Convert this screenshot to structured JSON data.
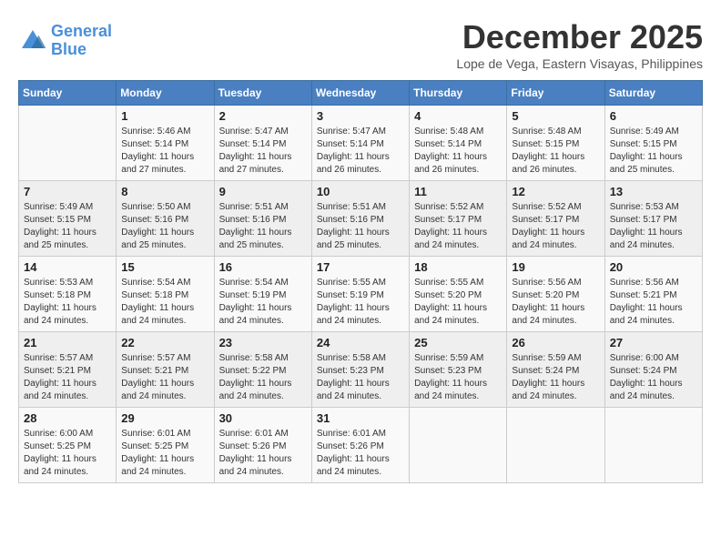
{
  "header": {
    "logo_line1": "General",
    "logo_line2": "Blue",
    "month": "December 2025",
    "location": "Lope de Vega, Eastern Visayas, Philippines"
  },
  "days_of_week": [
    "Sunday",
    "Monday",
    "Tuesday",
    "Wednesday",
    "Thursday",
    "Friday",
    "Saturday"
  ],
  "weeks": [
    [
      {
        "day": "",
        "sunrise": "",
        "sunset": "",
        "daylight": ""
      },
      {
        "day": "1",
        "sunrise": "Sunrise: 5:46 AM",
        "sunset": "Sunset: 5:14 PM",
        "daylight": "Daylight: 11 hours and 27 minutes."
      },
      {
        "day": "2",
        "sunrise": "Sunrise: 5:47 AM",
        "sunset": "Sunset: 5:14 PM",
        "daylight": "Daylight: 11 hours and 27 minutes."
      },
      {
        "day": "3",
        "sunrise": "Sunrise: 5:47 AM",
        "sunset": "Sunset: 5:14 PM",
        "daylight": "Daylight: 11 hours and 26 minutes."
      },
      {
        "day": "4",
        "sunrise": "Sunrise: 5:48 AM",
        "sunset": "Sunset: 5:14 PM",
        "daylight": "Daylight: 11 hours and 26 minutes."
      },
      {
        "day": "5",
        "sunrise": "Sunrise: 5:48 AM",
        "sunset": "Sunset: 5:15 PM",
        "daylight": "Daylight: 11 hours and 26 minutes."
      },
      {
        "day": "6",
        "sunrise": "Sunrise: 5:49 AM",
        "sunset": "Sunset: 5:15 PM",
        "daylight": "Daylight: 11 hours and 25 minutes."
      }
    ],
    [
      {
        "day": "7",
        "sunrise": "Sunrise: 5:49 AM",
        "sunset": "Sunset: 5:15 PM",
        "daylight": "Daylight: 11 hours and 25 minutes."
      },
      {
        "day": "8",
        "sunrise": "Sunrise: 5:50 AM",
        "sunset": "Sunset: 5:16 PM",
        "daylight": "Daylight: 11 hours and 25 minutes."
      },
      {
        "day": "9",
        "sunrise": "Sunrise: 5:51 AM",
        "sunset": "Sunset: 5:16 PM",
        "daylight": "Daylight: 11 hours and 25 minutes."
      },
      {
        "day": "10",
        "sunrise": "Sunrise: 5:51 AM",
        "sunset": "Sunset: 5:16 PM",
        "daylight": "Daylight: 11 hours and 25 minutes."
      },
      {
        "day": "11",
        "sunrise": "Sunrise: 5:52 AM",
        "sunset": "Sunset: 5:17 PM",
        "daylight": "Daylight: 11 hours and 24 minutes."
      },
      {
        "day": "12",
        "sunrise": "Sunrise: 5:52 AM",
        "sunset": "Sunset: 5:17 PM",
        "daylight": "Daylight: 11 hours and 24 minutes."
      },
      {
        "day": "13",
        "sunrise": "Sunrise: 5:53 AM",
        "sunset": "Sunset: 5:17 PM",
        "daylight": "Daylight: 11 hours and 24 minutes."
      }
    ],
    [
      {
        "day": "14",
        "sunrise": "Sunrise: 5:53 AM",
        "sunset": "Sunset: 5:18 PM",
        "daylight": "Daylight: 11 hours and 24 minutes."
      },
      {
        "day": "15",
        "sunrise": "Sunrise: 5:54 AM",
        "sunset": "Sunset: 5:18 PM",
        "daylight": "Daylight: 11 hours and 24 minutes."
      },
      {
        "day": "16",
        "sunrise": "Sunrise: 5:54 AM",
        "sunset": "Sunset: 5:19 PM",
        "daylight": "Daylight: 11 hours and 24 minutes."
      },
      {
        "day": "17",
        "sunrise": "Sunrise: 5:55 AM",
        "sunset": "Sunset: 5:19 PM",
        "daylight": "Daylight: 11 hours and 24 minutes."
      },
      {
        "day": "18",
        "sunrise": "Sunrise: 5:55 AM",
        "sunset": "Sunset: 5:20 PM",
        "daylight": "Daylight: 11 hours and 24 minutes."
      },
      {
        "day": "19",
        "sunrise": "Sunrise: 5:56 AM",
        "sunset": "Sunset: 5:20 PM",
        "daylight": "Daylight: 11 hours and 24 minutes."
      },
      {
        "day": "20",
        "sunrise": "Sunrise: 5:56 AM",
        "sunset": "Sunset: 5:21 PM",
        "daylight": "Daylight: 11 hours and 24 minutes."
      }
    ],
    [
      {
        "day": "21",
        "sunrise": "Sunrise: 5:57 AM",
        "sunset": "Sunset: 5:21 PM",
        "daylight": "Daylight: 11 hours and 24 minutes."
      },
      {
        "day": "22",
        "sunrise": "Sunrise: 5:57 AM",
        "sunset": "Sunset: 5:21 PM",
        "daylight": "Daylight: 11 hours and 24 minutes."
      },
      {
        "day": "23",
        "sunrise": "Sunrise: 5:58 AM",
        "sunset": "Sunset: 5:22 PM",
        "daylight": "Daylight: 11 hours and 24 minutes."
      },
      {
        "day": "24",
        "sunrise": "Sunrise: 5:58 AM",
        "sunset": "Sunset: 5:23 PM",
        "daylight": "Daylight: 11 hours and 24 minutes."
      },
      {
        "day": "25",
        "sunrise": "Sunrise: 5:59 AM",
        "sunset": "Sunset: 5:23 PM",
        "daylight": "Daylight: 11 hours and 24 minutes."
      },
      {
        "day": "26",
        "sunrise": "Sunrise: 5:59 AM",
        "sunset": "Sunset: 5:24 PM",
        "daylight": "Daylight: 11 hours and 24 minutes."
      },
      {
        "day": "27",
        "sunrise": "Sunrise: 6:00 AM",
        "sunset": "Sunset: 5:24 PM",
        "daylight": "Daylight: 11 hours and 24 minutes."
      }
    ],
    [
      {
        "day": "28",
        "sunrise": "Sunrise: 6:00 AM",
        "sunset": "Sunset: 5:25 PM",
        "daylight": "Daylight: 11 hours and 24 minutes."
      },
      {
        "day": "29",
        "sunrise": "Sunrise: 6:01 AM",
        "sunset": "Sunset: 5:25 PM",
        "daylight": "Daylight: 11 hours and 24 minutes."
      },
      {
        "day": "30",
        "sunrise": "Sunrise: 6:01 AM",
        "sunset": "Sunset: 5:26 PM",
        "daylight": "Daylight: 11 hours and 24 minutes."
      },
      {
        "day": "31",
        "sunrise": "Sunrise: 6:01 AM",
        "sunset": "Sunset: 5:26 PM",
        "daylight": "Daylight: 11 hours and 24 minutes."
      },
      {
        "day": "",
        "sunrise": "",
        "sunset": "",
        "daylight": ""
      },
      {
        "day": "",
        "sunrise": "",
        "sunset": "",
        "daylight": ""
      },
      {
        "day": "",
        "sunrise": "",
        "sunset": "",
        "daylight": ""
      }
    ]
  ]
}
